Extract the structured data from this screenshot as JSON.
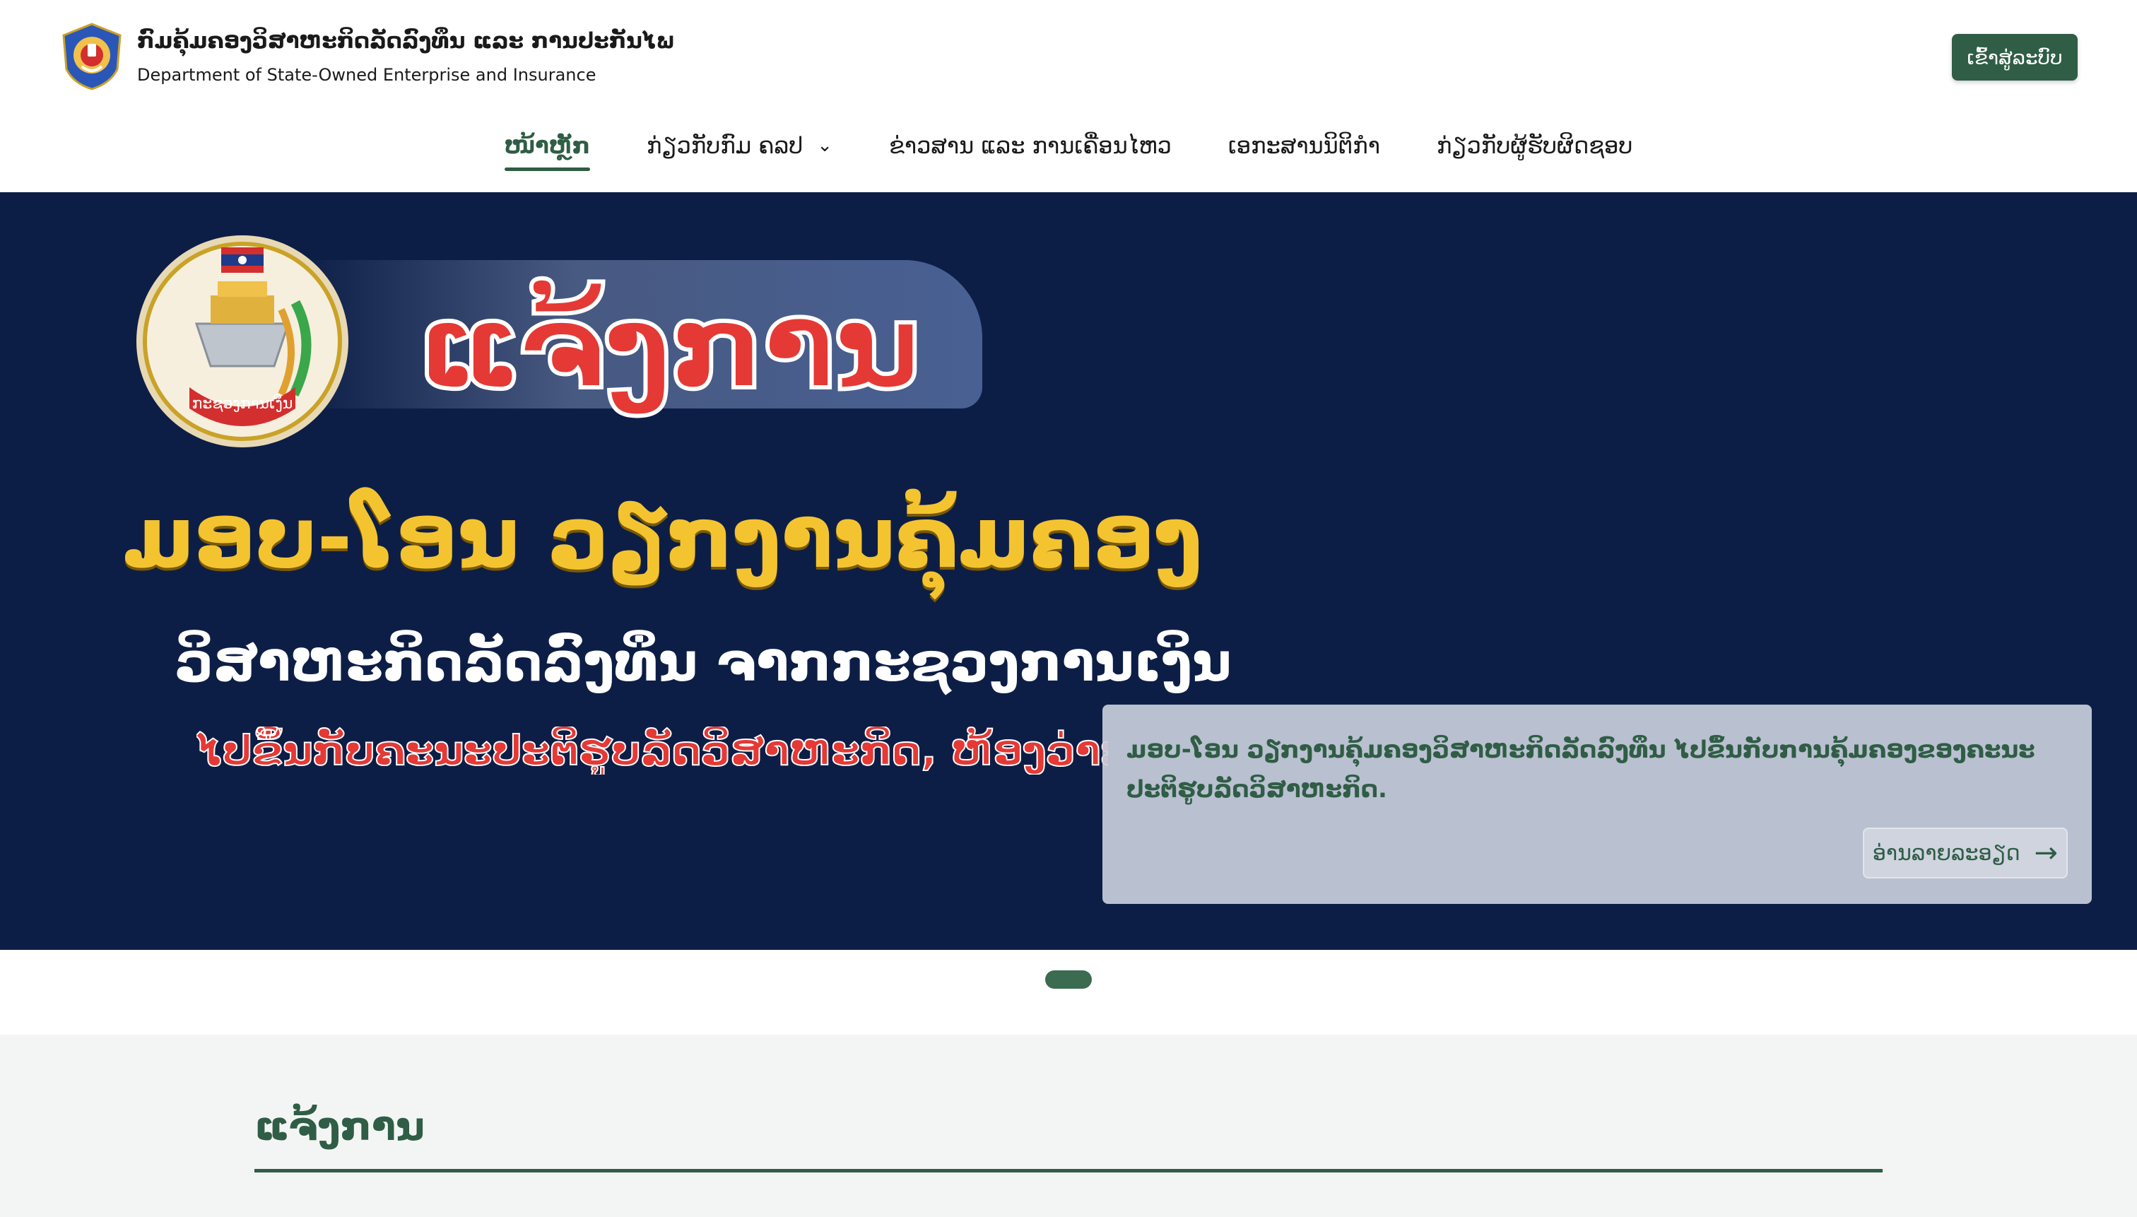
{
  "header": {
    "org_name_lo": "ກົມຄຸ້ມຄອງວິສາຫະກິດລັດລົງທຶນ ແລະ ການປະກັນໄພ",
    "org_name_en": "Department of State-Owned Enterprise and Insurance",
    "login_label": "ເຂົ້າສູ່ລະບົບ"
  },
  "nav": {
    "items": [
      {
        "label": "ໜ້າຫຼັກ",
        "active": true
      },
      {
        "label": "ກ່ຽວກັບກົມ ຄລປ",
        "has_dropdown": true
      },
      {
        "label": "ຂ່າວສານ ແລະ ການເຄື່ອນໄຫວ"
      },
      {
        "label": "ເອກະສານນິຕິກຳ"
      },
      {
        "label": "ກ່ຽວກັບຜູ້ຮັບຜິດຊອບ"
      }
    ]
  },
  "hero": {
    "banner_title": "ແຈ້ງການ",
    "banner_line1": "ມອບ-ໂອນ ວຽກງານຄຸ້ມຄອງ",
    "banner_line2": "ວິສາຫະກິດລັດລົງທຶນ ຈາກກະຊວງການເງິນ",
    "banner_line3": "ໄປຂຶ້ນກັບຄະນະປະຕິຮູບລັດວິສາຫະກິດ, ຫ້ອງວ່າການສູນກາງພັກ",
    "seal_text": "ກະຊວງການເງິນ",
    "caption": "ມອບ-ໂອນ ວຽກງານຄຸ້ມຄອງວິສາຫະກິດລັດລົງທຶນ ໄປຂຶ້ນກັບການຄຸ້ມຄອງຂອງຄະນະປະຕິຮູບລັດວິສາຫະກິດ.",
    "read_more_label": "ອ່ານລາຍລະອຽດ",
    "read_more_icon": "arrow-right-icon"
  },
  "carousel": {
    "active_index": 0,
    "count": 1
  },
  "section": {
    "title": "ແຈ້ງການ"
  },
  "colors": {
    "brand_green": "#2f5d45",
    "hero_bg": "#0d1e46",
    "alert_red": "#e53935",
    "gold": "#f4c430"
  }
}
